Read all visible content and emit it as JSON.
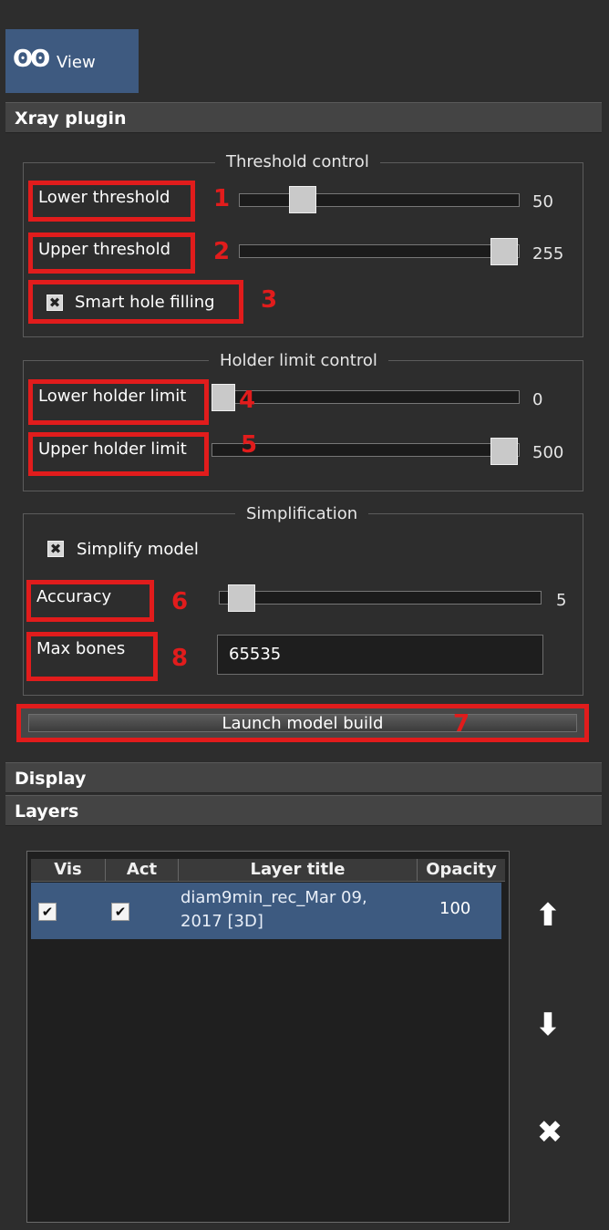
{
  "tab": {
    "label": "View",
    "icon": "glasses-icon"
  },
  "panels": {
    "xray": "Xray plugin",
    "display": "Display",
    "layers": "Layers"
  },
  "threshold": {
    "title": "Threshold control",
    "lower": {
      "label": "Lower threshold",
      "mark": "1",
      "value": "50"
    },
    "upper": {
      "label": "Upper threshold",
      "mark": "2",
      "value": "255"
    },
    "hole": {
      "label": "Smart hole filling",
      "mark": "3",
      "checked": true
    }
  },
  "holder": {
    "title": "Holder limit control",
    "lower": {
      "label": "Lower holder limit",
      "mark": "4",
      "value": "0"
    },
    "upper": {
      "label": "Upper holder limit",
      "mark": "5",
      "value": "500"
    }
  },
  "simplification": {
    "title": "Simplification",
    "simplify": {
      "label": "Simplify model",
      "checked": true
    },
    "accuracy": {
      "label": "Accuracy",
      "mark": "6",
      "value": "5"
    },
    "max_bones": {
      "label": "Max bones",
      "mark": "8",
      "value": "65535"
    }
  },
  "launch": {
    "label": "Launch model build",
    "mark": "7"
  },
  "layers_table": {
    "columns": [
      "Vis",
      "Act",
      "Layer title",
      "Opacity"
    ],
    "rows": [
      {
        "vis": true,
        "act": true,
        "title": "diam9min_rec_Mar 09, 2017   [3D]",
        "opacity": "100"
      }
    ]
  },
  "side_buttons": [
    "arrow-up-icon",
    "arrow-down-icon",
    "close-icon"
  ],
  "colors": {
    "accent": "#3e5a80",
    "annotation": "#e11c1c",
    "panel_bg": "#2d2d2d"
  }
}
